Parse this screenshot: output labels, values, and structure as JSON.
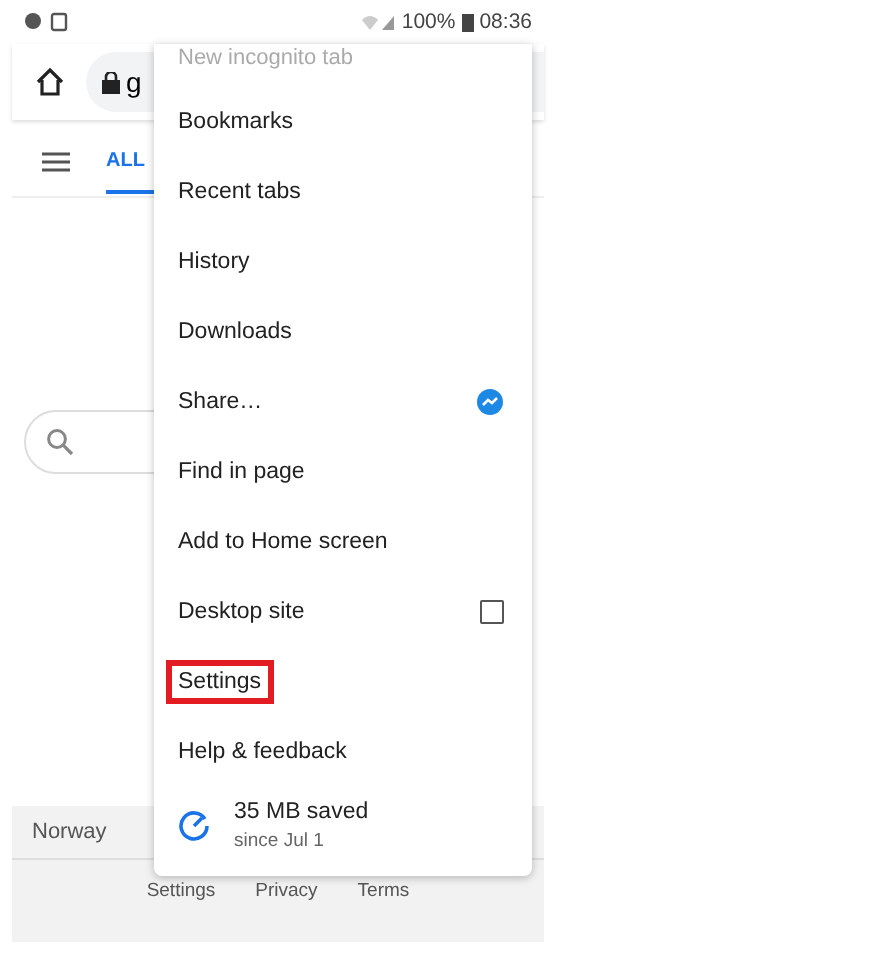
{
  "status_bar": {
    "battery": "100%",
    "time": "08:36"
  },
  "toolbar": {
    "url": "g"
  },
  "tabs": [
    {
      "label": "ALL",
      "selected": true
    }
  ],
  "footer": {
    "country": "Norway",
    "links": [
      "Settings",
      "Privacy",
      "Terms"
    ]
  },
  "menu": {
    "items": [
      {
        "kind": "cut",
        "label": "New incognito tab"
      },
      {
        "kind": "plain",
        "label": "Bookmarks",
        "highlighted": false
      },
      {
        "kind": "plain",
        "label": "Recent tabs",
        "highlighted": false
      },
      {
        "kind": "plain",
        "label": "History",
        "highlighted": false
      },
      {
        "kind": "plain",
        "label": "Downloads",
        "highlighted": false
      },
      {
        "kind": "share",
        "label": "Share…",
        "highlighted": false
      },
      {
        "kind": "plain",
        "label": "Find in page",
        "highlighted": false
      },
      {
        "kind": "plain",
        "label": "Add to Home screen",
        "highlighted": false
      },
      {
        "kind": "checkbox",
        "label": "Desktop site",
        "checked": false,
        "highlighted": false
      },
      {
        "kind": "plain",
        "label": "Settings",
        "highlighted": true
      },
      {
        "kind": "plain",
        "label": "Help & feedback",
        "highlighted": false
      },
      {
        "kind": "saver",
        "label": "35 MB saved",
        "subtitle": "since Jul 1"
      }
    ]
  }
}
